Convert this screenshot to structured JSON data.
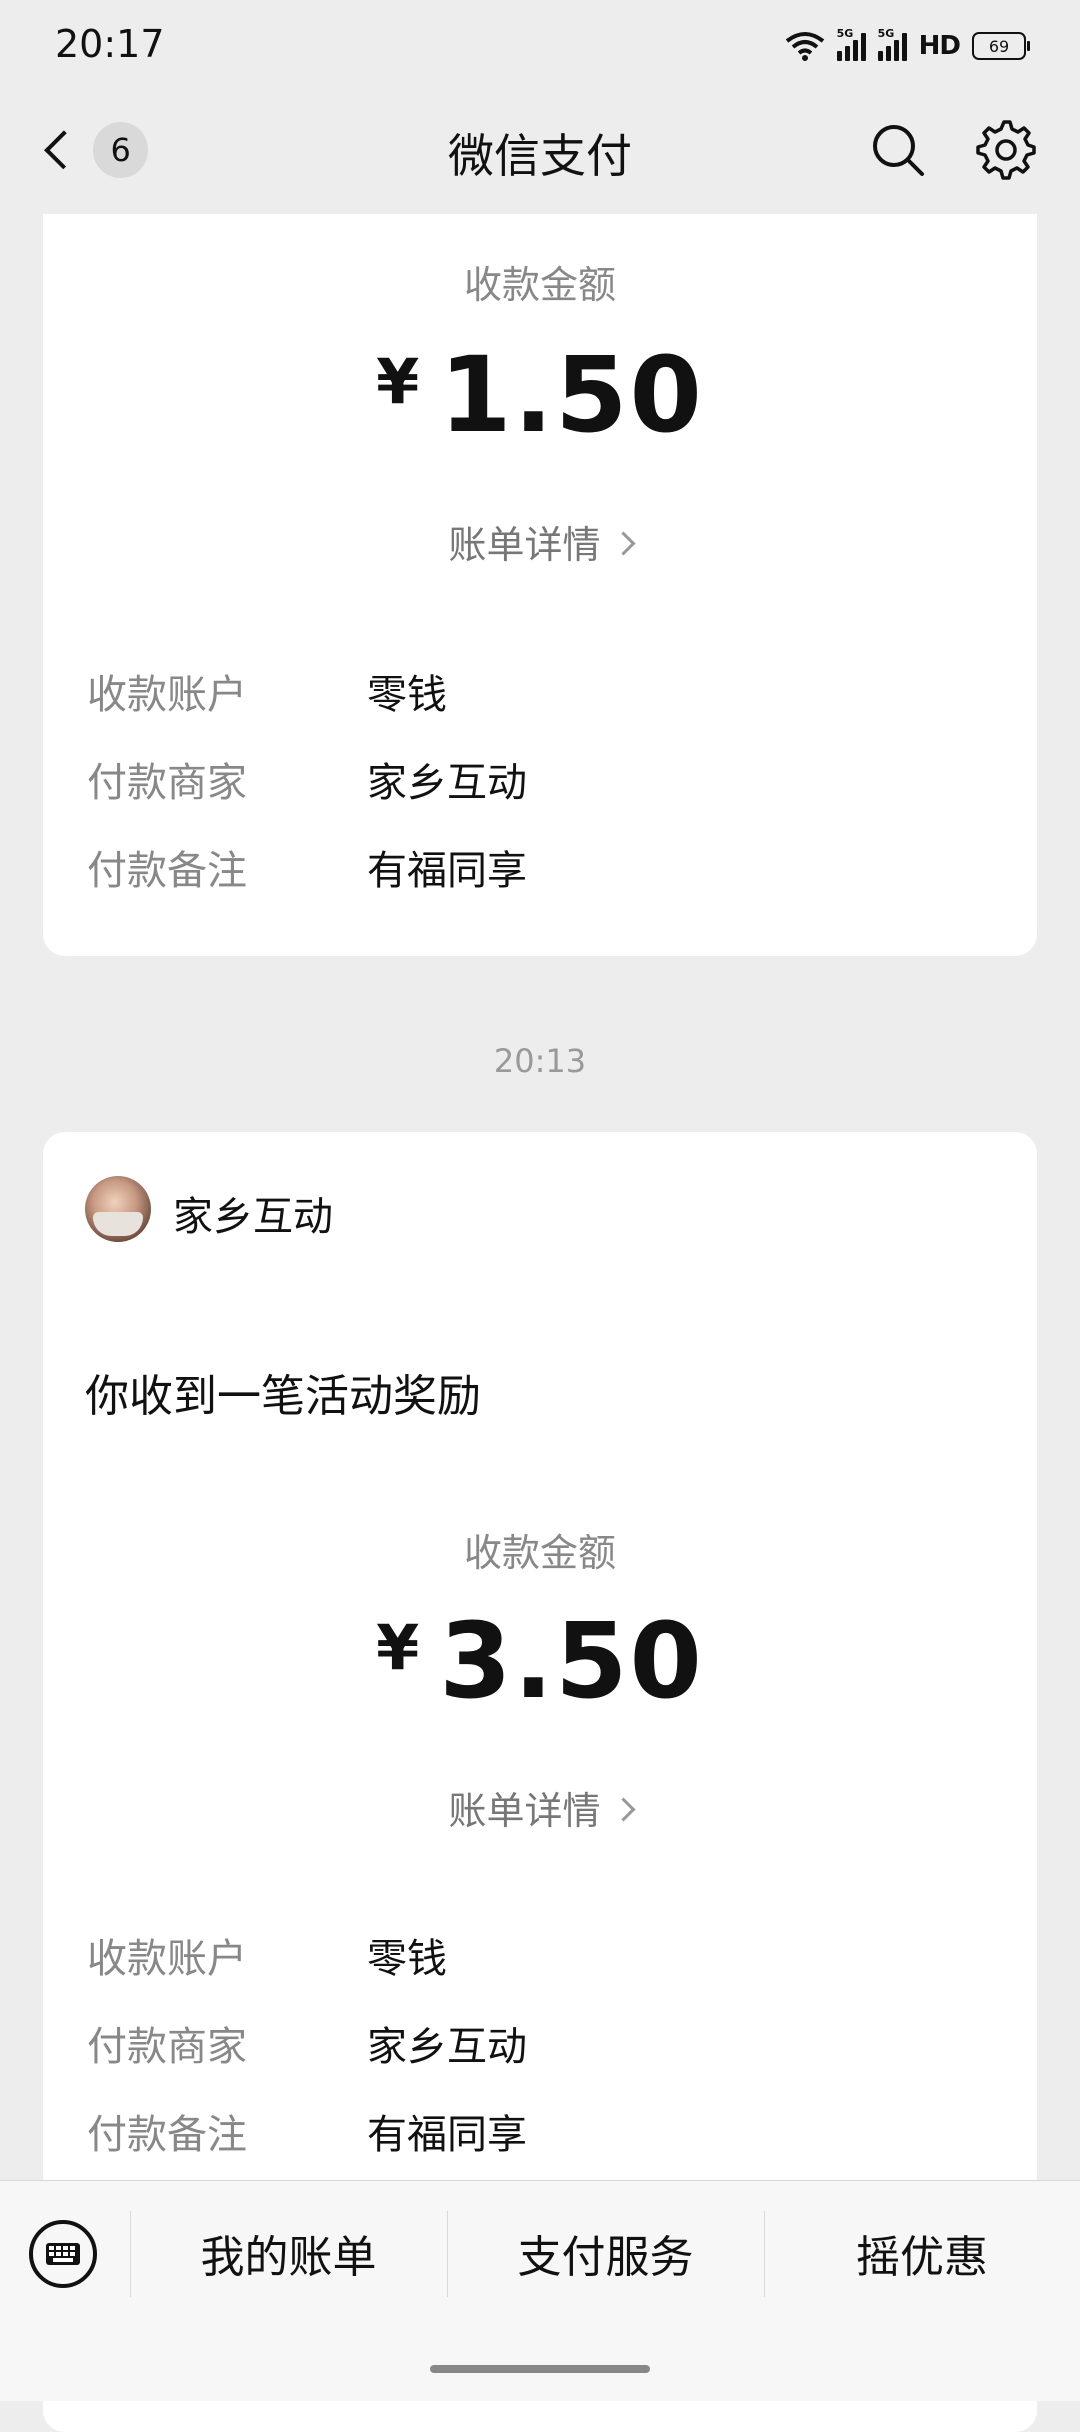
{
  "status_bar": {
    "time": "20:17",
    "network_1": "5G",
    "network_2": "5G",
    "hd": "HD",
    "battery": "69"
  },
  "nav": {
    "back_badge": "6",
    "title": "微信支付",
    "search_icon": "search-icon",
    "settings_icon": "gear-icon"
  },
  "messages": [
    {
      "amount_label": "收款金额",
      "currency": "¥",
      "amount": "1.50",
      "detail_link": "账单详情",
      "rows": [
        {
          "key": "收款账户",
          "value": "零钱"
        },
        {
          "key": "付款商家",
          "value": "家乡互动"
        },
        {
          "key": "付款备注",
          "value": "有福同享"
        }
      ]
    },
    {
      "time": "20:13",
      "merchant": "家乡互动",
      "notice": "你收到一笔活动奖励",
      "amount_label": "收款金额",
      "currency": "¥",
      "amount": "3.50",
      "detail_link": "账单详情",
      "rows": [
        {
          "key": "收款账户",
          "value": "零钱"
        },
        {
          "key": "付款商家",
          "value": "家乡互动"
        },
        {
          "key": "付款备注",
          "value": "有福同享"
        }
      ]
    }
  ],
  "bottom_menu": {
    "keyboard_icon": "keyboard-icon",
    "items": [
      "我的账单",
      "支付服务",
      "摇优惠"
    ]
  }
}
